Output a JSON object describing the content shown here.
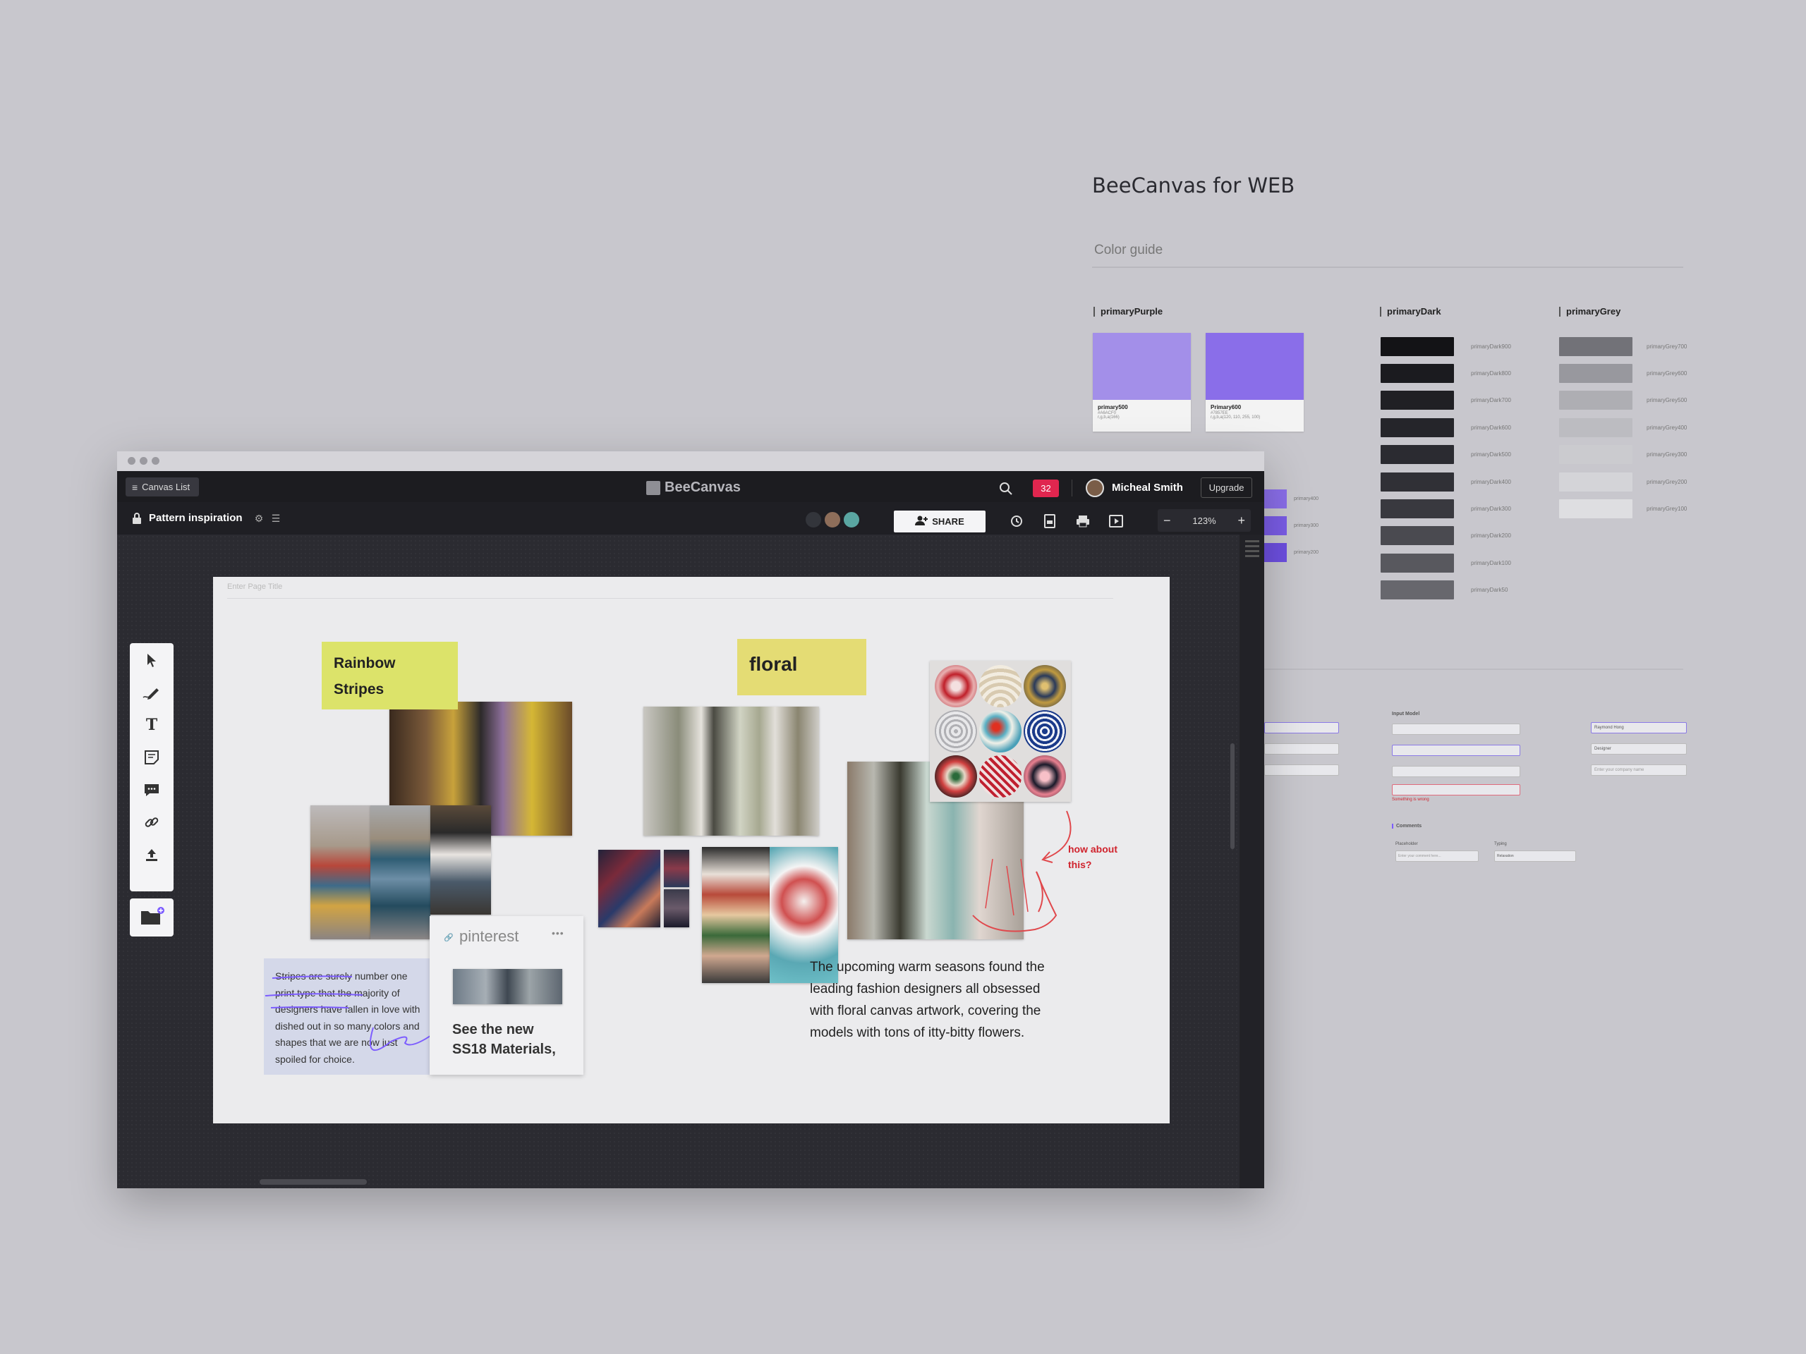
{
  "doc": {
    "title": "BeeCanvas for WEB",
    "section": "Color guide",
    "groups": {
      "purple": {
        "title": "primaryPurple",
        "swatches": [
          {
            "name": "primary500",
            "meta1": "#A6ACF0",
            "meta2": "r,g,b,a(166)",
            "color": "#a38fe9"
          },
          {
            "name": "Primary600",
            "meta1": "#7857EE",
            "meta2": "r,g,b,a(120, 110, 255, 100)",
            "color": "#8a6ee9"
          }
        ]
      },
      "dark": {
        "title": "primaryDark",
        "items": [
          {
            "name": "primaryDark900",
            "color": "#131316"
          },
          {
            "name": "primaryDark800",
            "color": "#1b1b1f"
          },
          {
            "name": "primaryDark700",
            "color": "#202024"
          },
          {
            "name": "primaryDark600",
            "color": "#25252a"
          },
          {
            "name": "primaryDark500",
            "color": "#2b2b31"
          },
          {
            "name": "primaryDark400",
            "color": "#303036"
          },
          {
            "name": "primaryDark300",
            "color": "#39393f"
          },
          {
            "name": "primaryDark200",
            "color": "#4a4a50"
          },
          {
            "name": "primaryDark100",
            "color": "#58585e"
          },
          {
            "name": "primaryDark50",
            "color": "#67676d"
          }
        ]
      },
      "grey": {
        "title": "primaryGrey",
        "items": [
          {
            "name": "primaryGrey700",
            "color": "#727278"
          },
          {
            "name": "primaryGrey600",
            "color": "#98989e"
          },
          {
            "name": "primaryGrey500",
            "color": "#aeaeb3"
          },
          {
            "name": "primaryGrey400",
            "color": "#bcbcc1"
          },
          {
            "name": "primaryGrey300",
            "color": "#cbcbcf"
          },
          {
            "name": "primaryGrey200",
            "color": "#d4d4d8"
          },
          {
            "name": "primaryGrey100",
            "color": "#dedee1"
          }
        ]
      },
      "purple_small": [
        "primary400",
        "primary300",
        "primary200"
      ]
    },
    "forms": {
      "input_model": "Input Model",
      "comments": "Comments",
      "placeholder_label": "Placeholder",
      "typing_label": "Typing",
      "placeholder_text": "Enter your comment here...",
      "typing_text": "Relaxation",
      "error_text": "Something is wrong",
      "name_value": "Raymond Hong",
      "designer_value": "Designer",
      "company_placeholder": "Enter your company name"
    }
  },
  "app": {
    "canvas_list": "Canvas List",
    "logo": "BeeCanvas",
    "notification_count": "32",
    "user_name": "Micheal Smith",
    "upgrade": "Upgrade",
    "canvas_title": "Pattern inspiration",
    "share": "SHARE",
    "zoom": "123%",
    "zoom_out": "−",
    "zoom_in": "+",
    "page_title_placeholder": "Enter Page Title"
  },
  "canvas": {
    "sticky1": "Rainbow Stripes",
    "sticky2": "floral",
    "note": "Stripes are surely number one print type that the majority of designers have fallen in love with dished out in so many colors and shapes that we are now just spoiled for choice.",
    "pinterest_label": "pinterest",
    "pinterest_more": "•••",
    "pinterest_title": "See the new SS18 Materials,",
    "floral_desc": "The upcoming warm seasons found the leading fashion designers all obsessed with floral canvas artwork, covering the models with tons of itty-bitty flowers.",
    "annotation": "how about this?"
  },
  "colors": {
    "accent": "#7c5cff",
    "badge": "#e0264f",
    "sticky_yellow": "#dce36a",
    "annotation_red": "#d0232d"
  }
}
